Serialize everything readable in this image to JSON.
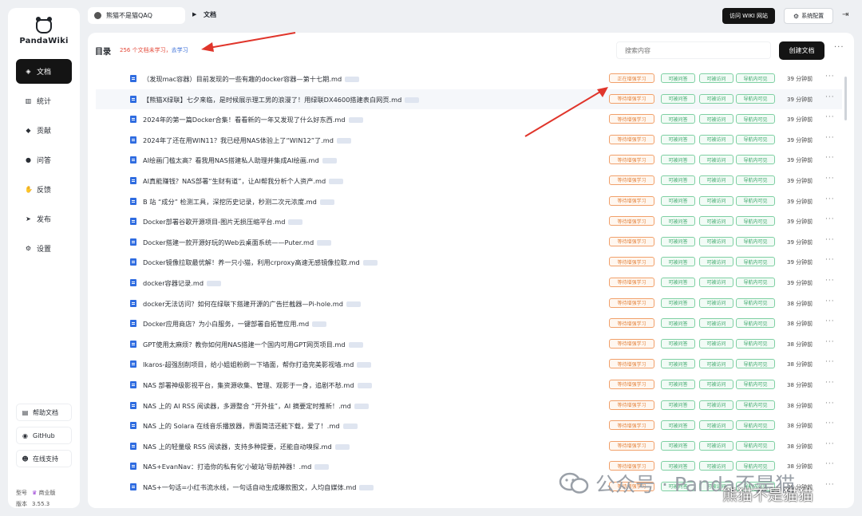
{
  "app": {
    "logo_text": "PandaWiki",
    "breadcrumb_space": "熊猫不是猫QAQ",
    "breadcrumb_page": "文档",
    "visit_wiki_label": "访问 WIKI 网站",
    "settings_label": "系统配置"
  },
  "sidebar": {
    "items": [
      {
        "label": "文档",
        "icon": "layers-icon",
        "active": true
      },
      {
        "label": "统计",
        "icon": "bar-chart-icon"
      },
      {
        "label": "贡献",
        "icon": "gem-icon"
      },
      {
        "label": "问答",
        "icon": "chat-icon"
      },
      {
        "label": "反馈",
        "icon": "hand-icon"
      },
      {
        "label": "发布",
        "icon": "send-icon"
      },
      {
        "label": "设置",
        "icon": "gear-icon"
      }
    ],
    "links": [
      {
        "label": "帮助文档",
        "icon": "doc-icon"
      },
      {
        "label": "GitHub",
        "icon": "github-icon"
      },
      {
        "label": "在线支持",
        "icon": "support-icon"
      }
    ],
    "meta": {
      "model_key": "型号",
      "model_value": "商业版",
      "version_key": "版本",
      "version_value": "3.55.3"
    }
  },
  "main": {
    "title": "目录",
    "learn_stat": "256 个文档未学习，",
    "learn_link": "去学习",
    "search_placeholder": "搜索内容",
    "create_label": "创建文档"
  },
  "status": {
    "learn_pending": "等待增强学习",
    "learn_active": "正在增强学习",
    "qa": "可被问答",
    "visit": "可被访问",
    "nav": "导航内可见"
  },
  "docs": [
    {
      "name": "（发现mac容器）目前发现的一些有趣的docker容器—第十七期.md",
      "learn": "正在增强学习",
      "time": "39 分钟前"
    },
    {
      "name": "【熊猫X绿联】七夕来临，是时候展示理工男的浪漫了！用绿联DX4600搭建表白网页.md",
      "learn": "等待增强学习",
      "time": "39 分钟前"
    },
    {
      "name": "2024年的第一篇Docker合集！看看新的一年又发现了什么好东西.md",
      "learn": "等待增强学习",
      "time": "39 分钟前"
    },
    {
      "name": "2024年了还在用WIN11？我已经用NAS体验上了“WIN12”了.md",
      "learn": "等待增强学习",
      "time": "39 分钟前"
    },
    {
      "name": "AI绘画门槛太高？看我用NAS搭建私人助理并集成AI绘画.md",
      "learn": "等待增强学习",
      "time": "39 分钟前"
    },
    {
      "name": "AI真能赚钱？NAS部署“生财有道”，让AI帮我分析个人资产.md",
      "learn": "等待增强学习",
      "time": "39 分钟前"
    },
    {
      "name": "B 站 “成分” 检测工具，深挖历史记录，秒测二次元浓度.md",
      "learn": "等待增强学习",
      "time": "39 分钟前"
    },
    {
      "name": "Docker部署谷歌开源项目-图片无损压缩平台.md",
      "learn": "等待增强学习",
      "time": "39 分钟前"
    },
    {
      "name": "Docker搭建一款开源好玩的Web云桌面系统——Puter.md",
      "learn": "等待增强学习",
      "time": "39 分钟前"
    },
    {
      "name": "Docker镜像拉取最优解！养一只小猫，利用crproxy高速无感镜像拉取.md",
      "learn": "等待增强学习",
      "time": "39 分钟前"
    },
    {
      "name": "docker容器记录.md",
      "learn": "等待增强学习",
      "time": "39 分钟前"
    },
    {
      "name": "docker无法访问？如何在绿联下搭建开源的广告拦截器—Pi-hole.md",
      "learn": "等待增强学习",
      "time": "38 分钟前"
    },
    {
      "name": "Docker应用商店？为小白服务，一键部署自拓管应用.md",
      "learn": "等待增强学习",
      "time": "38 分钟前"
    },
    {
      "name": "GPT使用太麻烦？教你如何用NAS搭建一个国内可用GPT网页项目.md",
      "learn": "等待增强学习",
      "time": "38 分钟前"
    },
    {
      "name": "Ikaros-超强刮削项目，给小姐姐粉刷一下墙面，帮你打造完美影视墙.md",
      "learn": "等待增强学习",
      "time": "38 分钟前"
    },
    {
      "name": "NAS 部署神级影视平台，集资源收集、管理、观影于一身，追剧不愁.md",
      "learn": "等待增强学习",
      "time": "38 分钟前"
    },
    {
      "name": "NAS 上的 AI RSS 阅读器，多源整合 “开外挂”，AI 摘要定时推新！.md",
      "learn": "等待增强学习",
      "time": "38 分钟前"
    },
    {
      "name": "NAS 上的 Solara 在线音乐播放器，界面简洁还能下载，爱了！.md",
      "learn": "等待增强学习",
      "time": "38 分钟前"
    },
    {
      "name": "NAS 上的轻量级 RSS 阅读器，支持多种提要，还能自动嗅探.md",
      "learn": "等待增强学习",
      "time": "38 分钟前"
    },
    {
      "name": "NAS+EvanNav：打造你的私有化'小破站'导航神器！.md",
      "learn": "等待增强学习",
      "time": "38 分钟前"
    },
    {
      "name": "NAS+一句话=小红书流水线，一句话自动生成爆款图文，人均自媒体.md",
      "learn": "等待增强学习",
      "time": "38 分钟前"
    }
  ],
  "watermark": {
    "text": "公众号 · Panda不是猫",
    "sub": "熊猫不是猫猫"
  },
  "colors": {
    "accent_dark": "#141414",
    "learn_badge": "#e4843f",
    "ok_badge": "#3ca86b",
    "link": "#3b6fd8",
    "annotation": "#e0352b"
  }
}
